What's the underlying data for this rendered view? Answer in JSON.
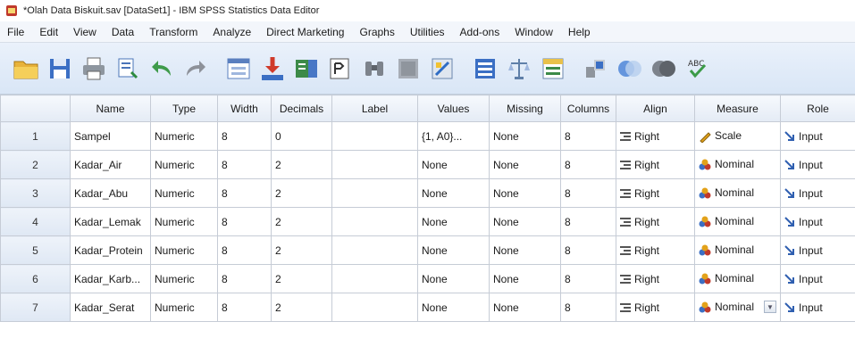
{
  "window": {
    "title": "*Olah Data Biskuit.sav [DataSet1] - IBM SPSS Statistics Data Editor"
  },
  "menubar": {
    "items": [
      "File",
      "Edit",
      "View",
      "Data",
      "Transform",
      "Analyze",
      "Direct Marketing",
      "Graphs",
      "Utilities",
      "Add-ons",
      "Window",
      "Help"
    ]
  },
  "toolbar": {
    "icons": [
      "open-folder-icon",
      "save-icon",
      "print-icon",
      "dialog-recall-icon",
      "undo-icon",
      "redo-icon",
      "goto-case-icon",
      "goto-variable-icon",
      "variables-icon",
      "find-icon",
      "insert-cases-icon",
      "insert-variable-icon",
      "split-file-icon",
      "weight-cases-icon",
      "select-cases-icon",
      "value-labels-icon",
      "use-sets-icon",
      "show-all-variables-icon",
      "spell-check-icon"
    ]
  },
  "grid": {
    "columns": [
      "",
      "Name",
      "Type",
      "Width",
      "Decimals",
      "Label",
      "Values",
      "Missing",
      "Columns",
      "Align",
      "Measure",
      "Role"
    ],
    "rows": [
      {
        "num": "1",
        "name": "Sampel",
        "type": "Numeric",
        "width": "8",
        "decimals": "0",
        "label": "",
        "values": "{1, A0}...",
        "missing": "None",
        "columns": "8",
        "align": "Right",
        "measure": "Scale",
        "role": "Input"
      },
      {
        "num": "2",
        "name": "Kadar_Air",
        "type": "Numeric",
        "width": "8",
        "decimals": "2",
        "label": "",
        "values": "None",
        "missing": "None",
        "columns": "8",
        "align": "Right",
        "measure": "Nominal",
        "role": "Input"
      },
      {
        "num": "3",
        "name": "Kadar_Abu",
        "type": "Numeric",
        "width": "8",
        "decimals": "2",
        "label": "",
        "values": "None",
        "missing": "None",
        "columns": "8",
        "align": "Right",
        "measure": "Nominal",
        "role": "Input"
      },
      {
        "num": "4",
        "name": "Kadar_Lemak",
        "type": "Numeric",
        "width": "8",
        "decimals": "2",
        "label": "",
        "values": "None",
        "missing": "None",
        "columns": "8",
        "align": "Right",
        "measure": "Nominal",
        "role": "Input"
      },
      {
        "num": "5",
        "name": "Kadar_Protein",
        "type": "Numeric",
        "width": "8",
        "decimals": "2",
        "label": "",
        "values": "None",
        "missing": "None",
        "columns": "8",
        "align": "Right",
        "measure": "Nominal",
        "role": "Input"
      },
      {
        "num": "6",
        "name": "Kadar_Karb...",
        "type": "Numeric",
        "width": "8",
        "decimals": "2",
        "label": "",
        "values": "None",
        "missing": "None",
        "columns": "8",
        "align": "Right",
        "measure": "Nominal",
        "role": "Input"
      },
      {
        "num": "7",
        "name": "Kadar_Serat",
        "type": "Numeric",
        "width": "8",
        "decimals": "2",
        "label": "",
        "values": "None",
        "missing": "None",
        "columns": "8",
        "align": "Right",
        "measure": "Nominal",
        "role": "Input"
      }
    ]
  }
}
